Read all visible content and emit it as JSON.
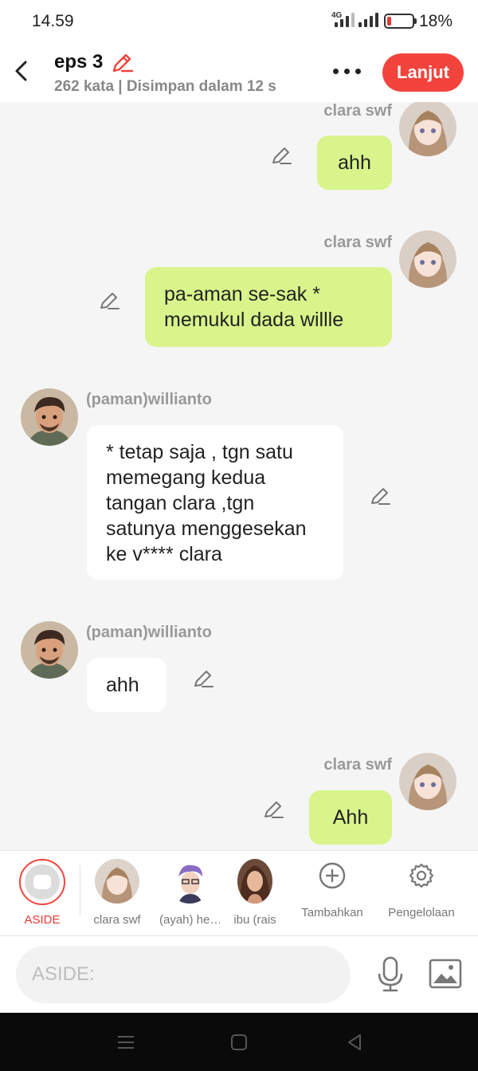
{
  "status": {
    "time": "14.59",
    "network": "4G",
    "battery": "18%",
    "battery_level": 0.18
  },
  "header": {
    "title": "eps 3",
    "subtitle": "262 kata | Disimpan dalam 12 s",
    "next_label": "Lanjut"
  },
  "messages": [
    {
      "sender": "clara swf",
      "side": "right",
      "text": "ahh"
    },
    {
      "sender": "clara swf",
      "side": "right",
      "text": "pa-aman se-sak * memukul dada willle"
    },
    {
      "sender": "(paman)willianto",
      "side": "left",
      "text": "* tetap saja  , tgn satu memegang kedua tangan clara ,tgn satunya menggesekan ke v**** clara"
    },
    {
      "sender": "(paman)willianto",
      "side": "left",
      "text": "ahh"
    },
    {
      "sender": "clara swf",
      "side": "right",
      "text": "Ahh"
    }
  ],
  "characters": {
    "aside_label": "ASIDE",
    "list": [
      {
        "name": "clara swf"
      },
      {
        "name": "(ayah) he…"
      },
      {
        "name": "ibu (rais"
      }
    ],
    "add_label": "Tambahkan",
    "manage_label": "Pengelolaan"
  },
  "composer": {
    "placeholder": "ASIDE:"
  },
  "colors": {
    "accent": "#f2443d",
    "my_bubble": "#d8f48b",
    "their_bubble": "#ffffff",
    "chat_bg": "#f5f5f5"
  }
}
